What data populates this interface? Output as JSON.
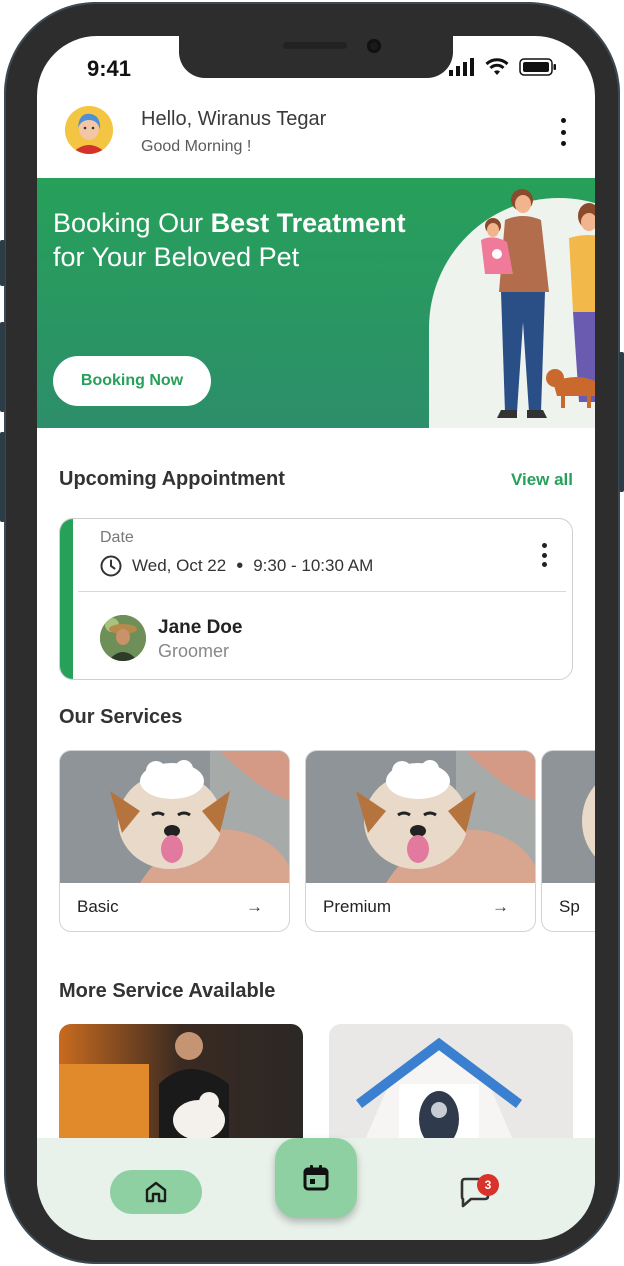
{
  "status_bar": {
    "time": "9:41"
  },
  "header": {
    "greeting": "Hello, Wiranus Tegar",
    "subtitle": "Good Morning !"
  },
  "banner": {
    "title_start": "Booking Our ",
    "title_bold": "Best Treatment",
    "title_end": "for Your Beloved Pet",
    "cta_label": "Booking Now"
  },
  "upcoming": {
    "section_title": "Upcoming Appointment",
    "view_all_label": "View all",
    "date_label": "Date",
    "date_value": "Wed, Oct 22",
    "time_value": "9:30 - 10:30 AM",
    "person_name": "Jane Doe",
    "person_role": "Groomer"
  },
  "services": {
    "section_title": "Our Services",
    "items": [
      {
        "label": "Basic"
      },
      {
        "label": "Premium"
      },
      {
        "label": "Sp"
      }
    ]
  },
  "more_services": {
    "section_title": "More Service Available"
  },
  "bottom_nav": {
    "chat_badge": "3"
  },
  "colors": {
    "accent": "#27a05a",
    "nav_active": "#8fd0a3",
    "badge": "#d8322b"
  },
  "icons": [
    "signal-icon",
    "wifi-icon",
    "battery-icon",
    "more-vertical-icon",
    "clock-icon",
    "arrow-right-icon",
    "home-icon",
    "calendar-icon",
    "chat-icon"
  ]
}
